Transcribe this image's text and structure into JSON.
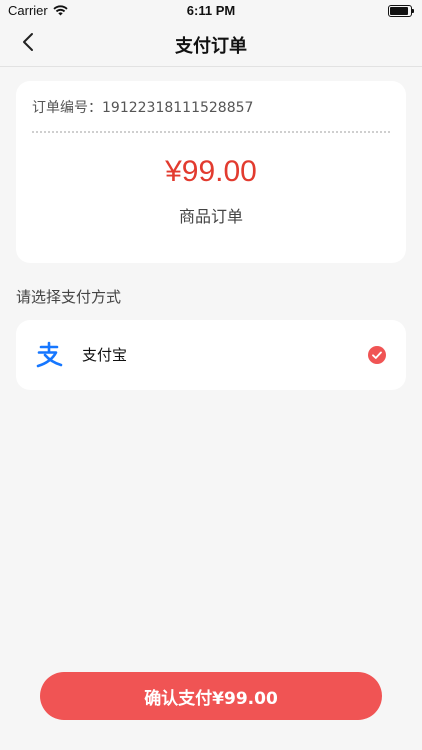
{
  "status_bar": {
    "carrier": "Carrier",
    "time": "6:11 PM",
    "wifi_icon": "wifi-icon",
    "battery_icon": "battery-icon",
    "battery_level": 1.0
  },
  "nav": {
    "back_icon": "chevron-left-icon",
    "title": "支付订单"
  },
  "order": {
    "number_label": "订单编号：",
    "number": "19122318111528857",
    "amount": "¥99.00",
    "type": "商品订单"
  },
  "payment": {
    "section_label": "请选择支付方式",
    "methods": [
      {
        "name": "支付宝",
        "icon": "alipay-icon",
        "selected": true
      }
    ]
  },
  "confirm": {
    "label": "确认支付¥99.00"
  },
  "colors": {
    "accent": "#f05454",
    "amount": "#e23b2f",
    "alipay": "#1677ff",
    "background": "#f6f6f6"
  }
}
